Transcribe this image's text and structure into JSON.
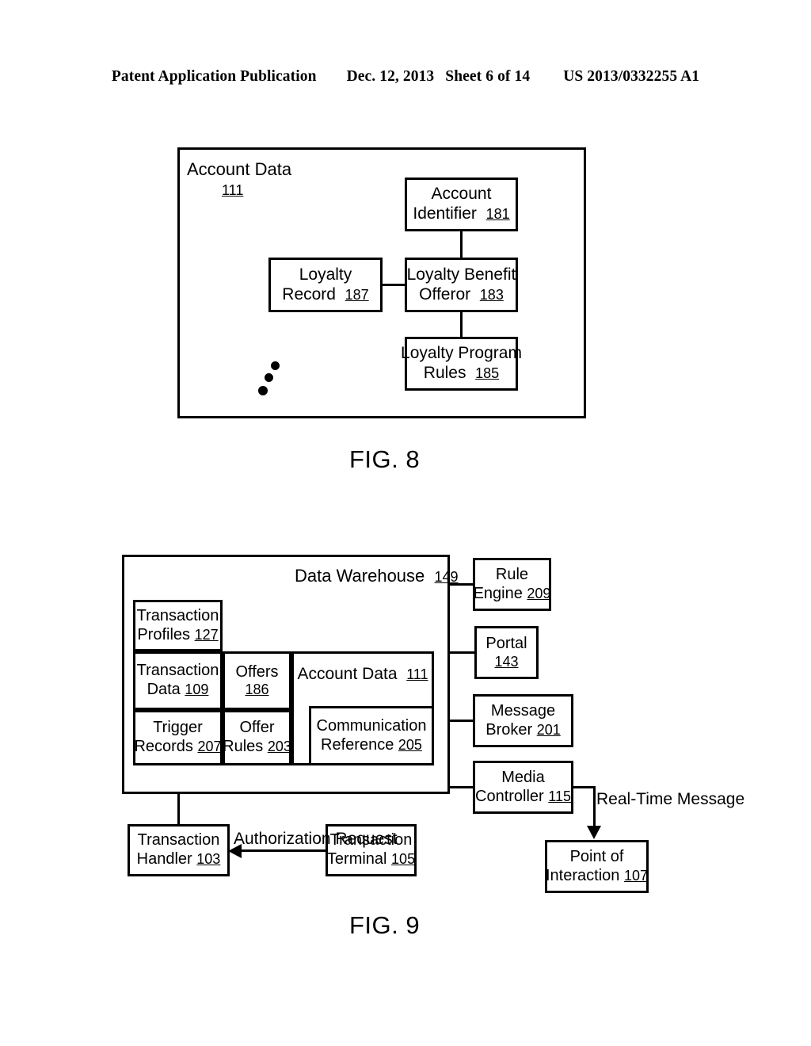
{
  "header": {
    "publication": "Patent Application Publication",
    "date": "Dec. 12, 2013",
    "sheet": "Sheet 6 of 14",
    "patent_number": "US 2013/0332255 A1"
  },
  "figures": [
    {
      "caption": "FIG. 8",
      "container": {
        "label": "Account Data",
        "ref": "111"
      },
      "boxes": [
        {
          "line1": "Account",
          "line2": "Identifier",
          "ref": "181"
        },
        {
          "line1": "Loyalty",
          "line2": "Record",
          "ref": "187"
        },
        {
          "line1": "Loyalty Benefit",
          "line2": "Offeror",
          "ref": "183"
        },
        {
          "line1": "Loyalty Program",
          "line2": "Rules",
          "ref": "185"
        }
      ],
      "ellipsis": "three diagonal dots"
    },
    {
      "caption": "FIG. 9",
      "container": {
        "label": "Data Warehouse",
        "ref": "149"
      },
      "warehouse_cells": [
        {
          "line1": "Transaction",
          "line2": "Profiles",
          "ref": "127"
        },
        {
          "line1": "Transaction",
          "line2": "Data",
          "ref": "109"
        },
        {
          "line1": "Offers",
          "line2": "",
          "ref": "186"
        },
        {
          "line1": "Trigger",
          "line2": "Records",
          "ref": "207"
        },
        {
          "line1": "Offer",
          "line2": "Rules",
          "ref": "203"
        },
        {
          "line1": "Account Data",
          "line2": "",
          "ref": "111"
        },
        {
          "line1": "Communication",
          "line2": "Reference",
          "ref": "205"
        }
      ],
      "right_boxes": [
        {
          "line1": "Rule",
          "line2": "Engine",
          "ref": "209"
        },
        {
          "line1": "Portal",
          "line2": "",
          "ref": "143"
        },
        {
          "line1": "Message",
          "line2": "Broker",
          "ref": "201"
        },
        {
          "line1": "Media",
          "line2": "Controller",
          "ref": "115"
        }
      ],
      "bottom_boxes": [
        {
          "line1": "Transaction",
          "line2": "Handler",
          "ref": "103"
        },
        {
          "line1": "Transaction",
          "line2": "Terminal",
          "ref": "105"
        },
        {
          "line1": "Point of",
          "line2": "Interaction",
          "ref": "107"
        }
      ],
      "edge_labels": [
        {
          "line1": "Authorization",
          "line2": "Request"
        },
        {
          "line1": "Real-Time",
          "line2": "Message"
        }
      ]
    }
  ]
}
